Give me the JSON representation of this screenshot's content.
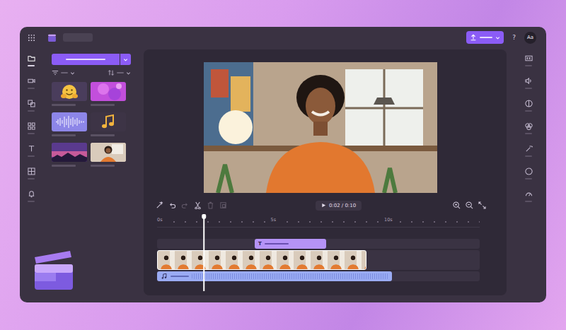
{
  "topbar": {
    "help": "?",
    "avatar": "Aa"
  },
  "left_rail": [
    {
      "selected": true
    },
    {
      "selected": false
    },
    {
      "selected": false
    },
    {
      "selected": false
    },
    {
      "selected": false
    },
    {
      "selected": false
    },
    {
      "selected": false
    }
  ],
  "media_panel": {
    "thumbnails": [
      {
        "kind": "sticker",
        "color": "#4a3d5c"
      },
      {
        "kind": "background",
        "color": "#c24fdc"
      },
      {
        "kind": "audio",
        "color": "#8d86e8"
      },
      {
        "kind": "music",
        "color": "#3d3446"
      },
      {
        "kind": "landscape",
        "color": "#6a3c8c"
      },
      {
        "kind": "video",
        "color": "#d9cbbb"
      }
    ]
  },
  "timeline": {
    "toolbar": [
      {
        "disabled": false
      },
      {
        "disabled": false
      },
      {
        "disabled": true
      },
      {
        "disabled": false
      },
      {
        "disabled": true
      },
      {
        "disabled": true
      }
    ],
    "time": "0:02 / 0:10",
    "ruler": [
      "0s",
      "5s",
      "10s"
    ],
    "playhead": {
      "level": 0.145
    },
    "text_clip": {
      "icon": "T"
    }
  },
  "right_rail": [
    {
      "selected": false
    },
    {
      "selected": false
    },
    {
      "selected": false
    },
    {
      "selected": false
    },
    {
      "selected": false
    },
    {
      "selected": false
    },
    {
      "selected": false
    }
  ]
}
